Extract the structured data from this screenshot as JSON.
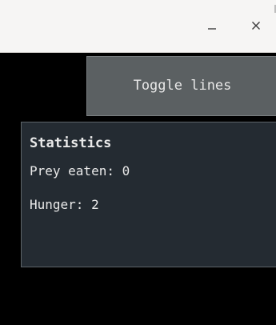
{
  "window": {
    "controls": {
      "minimize_icon": "minimize-icon",
      "close_icon": "close-icon"
    }
  },
  "toolbar": {
    "toggle_lines_label": "Toggle lines"
  },
  "statistics": {
    "title": "Statistics",
    "prey_eaten_text": "Prey eaten: 0",
    "hunger_text": "Hunger: 2"
  },
  "colors": {
    "titlebar_bg": "#f6f5f4",
    "canvas_bg": "#000000",
    "button_bg": "#5b6062",
    "panel_bg": "#242b32",
    "text": "#e9e9e9"
  }
}
